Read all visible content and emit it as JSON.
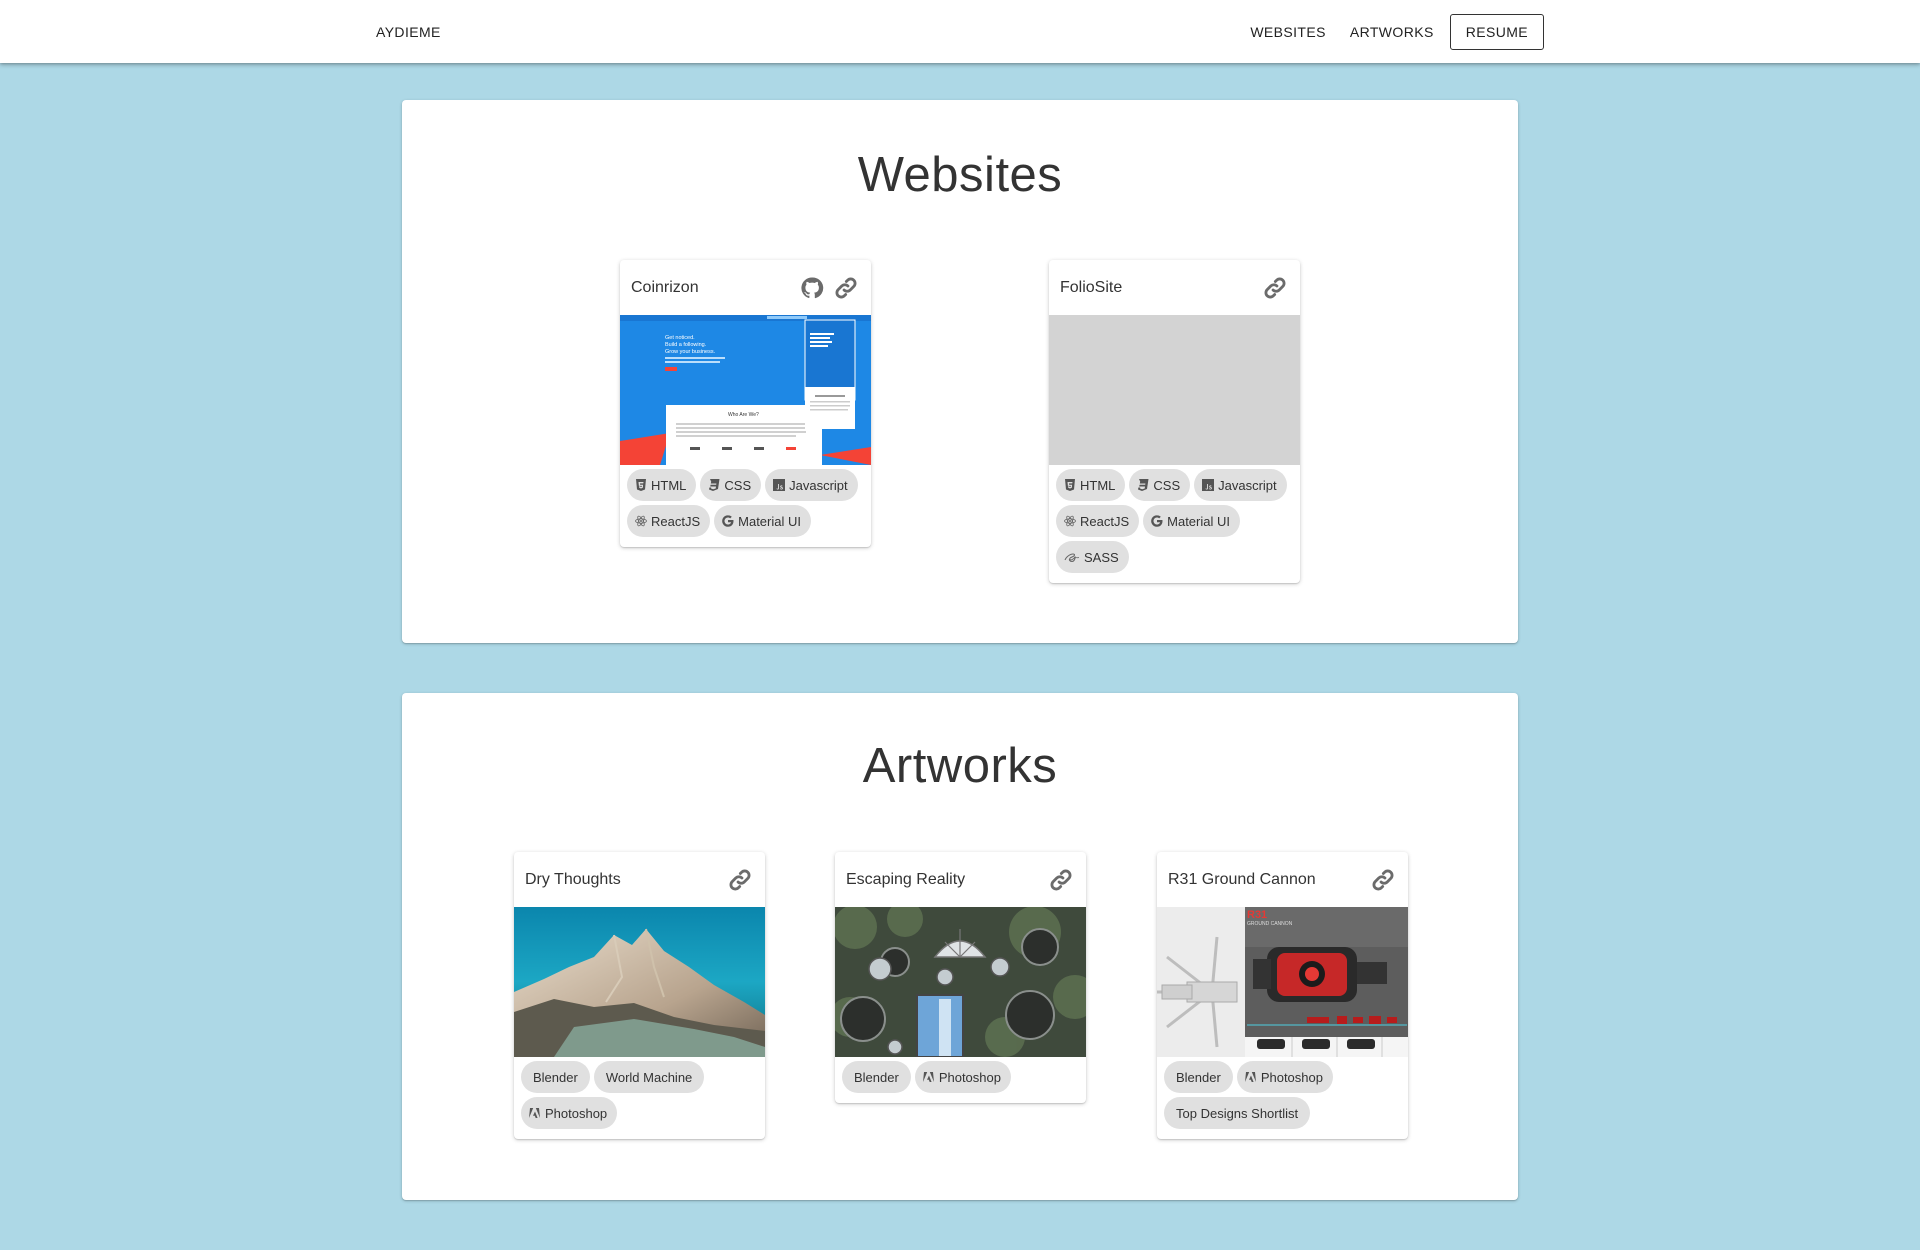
{
  "nav": {
    "brand": "AYDIEME",
    "links": [
      "WEBSITES",
      "ARTWORKS"
    ],
    "resume": "RESUME"
  },
  "websites": {
    "title": "Websites",
    "cards": [
      {
        "title": "Coinrizon",
        "has_github": true,
        "thumb_text": {
          "hero_line1": "Get noticed.",
          "hero_line2": "Build a following.",
          "hero_line3": "Grow your business.",
          "about_heading": "Who Are We?"
        },
        "chips": [
          {
            "label": "HTML",
            "icon": "html5-icon"
          },
          {
            "label": "CSS",
            "icon": "css3-icon"
          },
          {
            "label": "Javascript",
            "icon": "javascript-icon"
          },
          {
            "label": "ReactJS",
            "icon": "react-icon"
          },
          {
            "label": "Material UI",
            "icon": "google-icon"
          }
        ]
      },
      {
        "title": "FolioSite",
        "has_github": false,
        "chips": [
          {
            "label": "HTML",
            "icon": "html5-icon"
          },
          {
            "label": "CSS",
            "icon": "css3-icon"
          },
          {
            "label": "Javascript",
            "icon": "javascript-icon"
          },
          {
            "label": "ReactJS",
            "icon": "react-icon"
          },
          {
            "label": "Material UI",
            "icon": "google-icon"
          },
          {
            "label": "SASS",
            "icon": "sass-icon"
          }
        ]
      }
    ]
  },
  "artworks": {
    "title": "Artworks",
    "cards": [
      {
        "title": "Dry Thoughts",
        "chips": [
          {
            "label": "Blender",
            "icon": ""
          },
          {
            "label": "World Machine",
            "icon": ""
          },
          {
            "label": "Photoshop",
            "icon": "adobe-icon"
          }
        ]
      },
      {
        "title": "Escaping Reality",
        "chips": [
          {
            "label": "Blender",
            "icon": ""
          },
          {
            "label": "Photoshop",
            "icon": "adobe-icon"
          }
        ]
      },
      {
        "title": "R31 Ground Cannon",
        "thumb_text": {
          "logo": "R31",
          "subtitle": "GROUND CANNON"
        },
        "chips": [
          {
            "label": "Blender",
            "icon": ""
          },
          {
            "label": "Photoshop",
            "icon": "adobe-icon"
          },
          {
            "label": "Top Designs Shortlist",
            "icon": ""
          }
        ]
      }
    ]
  },
  "colors": {
    "page_background": "#add8e6",
    "card_background": "#ffffff",
    "chip_background": "#e0e0e0",
    "coinrizon_blue": "#1e88e5",
    "placeholder_grey": "#d3d3d3"
  }
}
